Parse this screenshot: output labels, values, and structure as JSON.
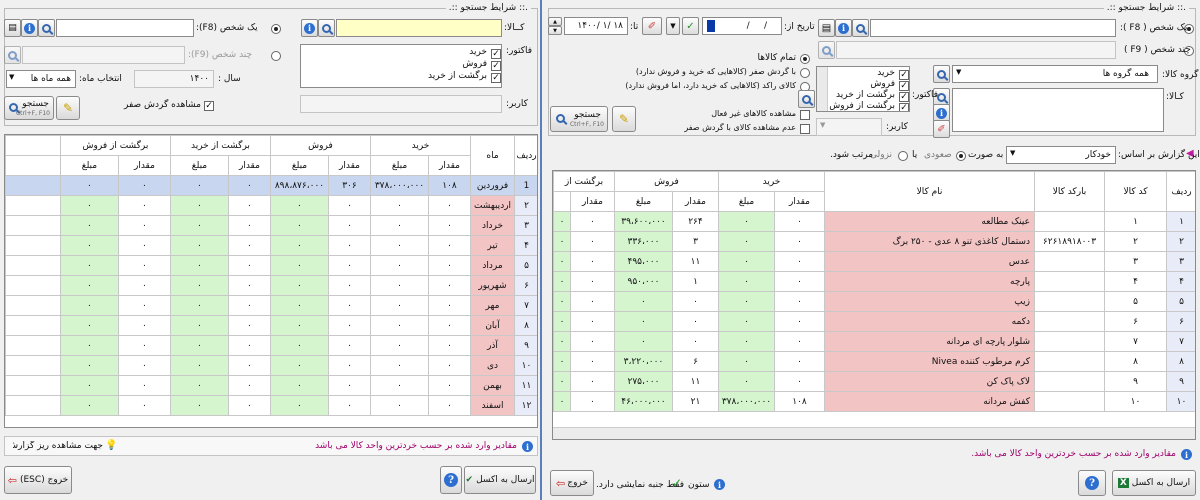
{
  "left": {
    "group_title": ".:: شرایط جستجو ::.",
    "kala_label": "کــالا:",
    "one_person": "یک شخص (F8):",
    "multi_person": "چند شخص (F9):",
    "factor_label": "فاکتور:",
    "factor_items": [
      "خرید",
      "فروش",
      "برگشت از خرید"
    ],
    "year_label": "سال :",
    "year_value": "۱۴۰۰",
    "month_label": "انتخاب ماه:",
    "month_value": "همه ماه ها",
    "karbar_label": "کاربر:",
    "zero_label": "مشاهده گردش صفر",
    "search_label": "جستجو",
    "search_hotkey": "Ctrl+F, F10",
    "headers": {
      "radif": "ردیف",
      "mah": "ماه",
      "kharid": "خرید",
      "forush": "فروش",
      "bargasht_kharid": "برگشت از خرید",
      "bargasht_forush": "برگشت از فروش",
      "meghdar": "مقدار",
      "mablagh": "مبلغ"
    },
    "rows": [
      [
        "1",
        "فروردین",
        "۱۰۸",
        "۳۷۸،۰۰۰،۰۰۰",
        "۳۰۶",
        "۸۹۸،۸۷۶،۰۰۰",
        "۰",
        "۰",
        "۰",
        "۰"
      ],
      [
        "۲",
        "اردیبهشت",
        "۰",
        "۰",
        "۰",
        "۰",
        "۰",
        "۰",
        "۰",
        "۰"
      ],
      [
        "۳",
        "خرداد",
        "۰",
        "۰",
        "۰",
        "۰",
        "۰",
        "۰",
        "۰",
        "۰"
      ],
      [
        "۴",
        "تیر",
        "۰",
        "۰",
        "۰",
        "۰",
        "۰",
        "۰",
        "۰",
        "۰"
      ],
      [
        "۵",
        "مرداد",
        "۰",
        "۰",
        "۰",
        "۰",
        "۰",
        "۰",
        "۰",
        "۰"
      ],
      [
        "۶",
        "شهریور",
        "۰",
        "۰",
        "۰",
        "۰",
        "۰",
        "۰",
        "۰",
        "۰"
      ],
      [
        "۷",
        "مهر",
        "۰",
        "۰",
        "۰",
        "۰",
        "۰",
        "۰",
        "۰",
        "۰"
      ],
      [
        "۸",
        "آبان",
        "۰",
        "۰",
        "۰",
        "۰",
        "۰",
        "۰",
        "۰",
        "۰"
      ],
      [
        "۹",
        "آذر",
        "۰",
        "۰",
        "۰",
        "۰",
        "۰",
        "۰",
        "۰",
        "۰"
      ],
      [
        "۱۰",
        "دی",
        "۰",
        "۰",
        "۰",
        "۰",
        "۰",
        "۰",
        "۰",
        "۰"
      ],
      [
        "۱۱",
        "بهمن",
        "۰",
        "۰",
        "۰",
        "۰",
        "۰",
        "۰",
        "۰",
        "۰"
      ],
      [
        "۱۲",
        "اسفند",
        "۰",
        "۰",
        "۰",
        "۰",
        "۰",
        "۰",
        "۰",
        "۰"
      ]
    ],
    "info_text": "مقادیر وارد شده بر حسب خردترین واحد کالا می باشد",
    "hint_text": "جهت مشاهده ریز گزارش، بر روی ردیف  مد نظر دابل کلیک نمایید.",
    "excel_label": "ارسال به اکسل",
    "exit_label": "خروج (ESC)"
  },
  "right": {
    "group_title": ".:: شرایط جستجو ::.",
    "one_person": "یک شخص ( F8 ):",
    "multi_person": "چند شخص ( F9 )",
    "date_from_label": "تاریخ از:",
    "date_from_value": "/     /",
    "date_to_label": "تا:",
    "date_to_value": "۱۴۰۰/ ۱/ ۱۸",
    "group_label": "گروه کالا:",
    "group_value": "همه گروه ها",
    "kala_label": "کـالا:",
    "factor_label": "فاکتور:",
    "factor_items": [
      "خرید",
      "فروش",
      "برگشت از خرید",
      "برگشت از فروش"
    ],
    "karbar_label": "کاربر:",
    "radio_all": "تمام کالاها",
    "radio_zero": "با گردش صفر (کالاهایی که خرید و فروش ندارد)",
    "radio_stagnant": "کالای راکد (کالاهایی که خرید دارد، اما فروش ندارد)",
    "cb_inactive": "مشاهده کالاهای غیر فعال",
    "cb_nozero": "عدم مشاهده کالای با گردش صفر",
    "search_label": "جستجو",
    "search_hotkey": "Ctrl+F, F10",
    "sort_label": "این گزارش بر اساس:",
    "sort_value": "خودکار",
    "sort_as": "به صورت",
    "sort_asc": "صعودی",
    "sort_or": "یا",
    "sort_desc": "نزولی",
    "sort_end": "مرتب شود.",
    "headers": {
      "radif": "ردیف",
      "code": "کد کالا",
      "barcode": "بارکد کالا",
      "name": "نام کالا",
      "kharid": "خرید",
      "forush": "فروش",
      "bargasht": "برگشت از",
      "meghdar": "مقدار",
      "mablagh": "مبلغ"
    },
    "rows": [
      [
        "۱",
        "۱",
        "",
        "عینک مطالعه",
        "۰",
        "۰",
        "۲۶۴",
        "۳۹،۶۰۰،۰۰۰",
        "۰",
        "۰"
      ],
      [
        "۲",
        "۲",
        "۶۲۶۱۸۹۱۸۰۰۳",
        "دستمال کاغذی تنو ۸ عدی - ۲۵۰ برگ",
        "۰",
        "۰",
        "۳",
        "۳۳۶،۰۰۰",
        "۰",
        "۰"
      ],
      [
        "۳",
        "۳",
        "",
        "عدس",
        "۰",
        "۰",
        "۱۱",
        "۴۹۵،۰۰۰",
        "۰",
        "۰"
      ],
      [
        "۴",
        "۴",
        "",
        "پارچه",
        "۰",
        "۰",
        "۱",
        "۹۵۰،۰۰۰",
        "۰",
        "۰"
      ],
      [
        "۵",
        "۵",
        "",
        "زیپ",
        "۰",
        "۰",
        "۰",
        "۰",
        "۰",
        "۰"
      ],
      [
        "۶",
        "۶",
        "",
        "دکمه",
        "۰",
        "۰",
        "۰",
        "۰",
        "۰",
        "۰"
      ],
      [
        "۷",
        "۷",
        "",
        "شلوار پارچه ای مردانه",
        "۰",
        "۰",
        "۰",
        "۰",
        "۰",
        "۰"
      ],
      [
        "۸",
        "۸",
        "",
        "کرم مرطوب کننده Nivea",
        "۰",
        "۰",
        "۶",
        "۳،۲۲۰،۰۰۰",
        "۰",
        "۰"
      ],
      [
        "۹",
        "۹",
        "",
        "لاک پاک کن",
        "۰",
        "۰",
        "۱۱",
        "۲۷۵،۰۰۰",
        "۰",
        "۰"
      ],
      [
        "۱۰",
        "۱۰",
        "",
        "کفش مردانه",
        "۱۰۸",
        "۳۷۸،۰۰۰،۰۰۰",
        "۲۱",
        "۴۶،۰۰۰،۰۰۰",
        "۰",
        "۰"
      ]
    ],
    "info_text": "مقادیر وارد شده بر حسب خردترین واحد کالا می باشد.",
    "legend_col": "ستون",
    "legend_only": "فقط جنبه نمایشی دارد.",
    "excel_label": "ارسال به اکسل",
    "exit_label": "خروج"
  }
}
